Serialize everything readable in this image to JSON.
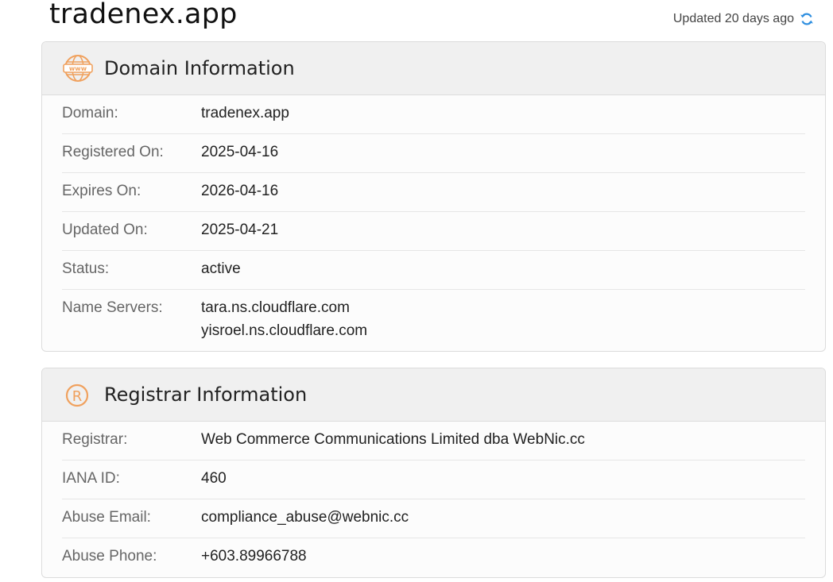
{
  "domain": "tradenex.app",
  "updated_text": "Updated 20 days ago",
  "accent_color": "#f0a15e",
  "domain_info": {
    "title": "Domain Information",
    "icon": "www-globe-icon",
    "rows": [
      {
        "label": "Domain:",
        "values": [
          "tradenex.app"
        ]
      },
      {
        "label": "Registered On:",
        "values": [
          "2025-04-16"
        ]
      },
      {
        "label": "Expires On:",
        "values": [
          "2026-04-16"
        ]
      },
      {
        "label": "Updated On:",
        "values": [
          "2025-04-21"
        ]
      },
      {
        "label": "Status:",
        "values": [
          "active"
        ]
      },
      {
        "label": "Name Servers:",
        "values": [
          "tara.ns.cloudflare.com",
          "yisroel.ns.cloudflare.com"
        ]
      }
    ]
  },
  "registrar_info": {
    "title": "Registrar Information",
    "icon": "registered-icon",
    "rows": [
      {
        "label": "Registrar:",
        "values": [
          "Web Commerce Communications Limited dba WebNic.cc"
        ]
      },
      {
        "label": "IANA ID:",
        "values": [
          "460"
        ]
      },
      {
        "label": "Abuse Email:",
        "values": [
          "compliance_abuse@webnic.cc"
        ]
      },
      {
        "label": "Abuse Phone:",
        "values": [
          "+603.89966788"
        ]
      }
    ]
  }
}
